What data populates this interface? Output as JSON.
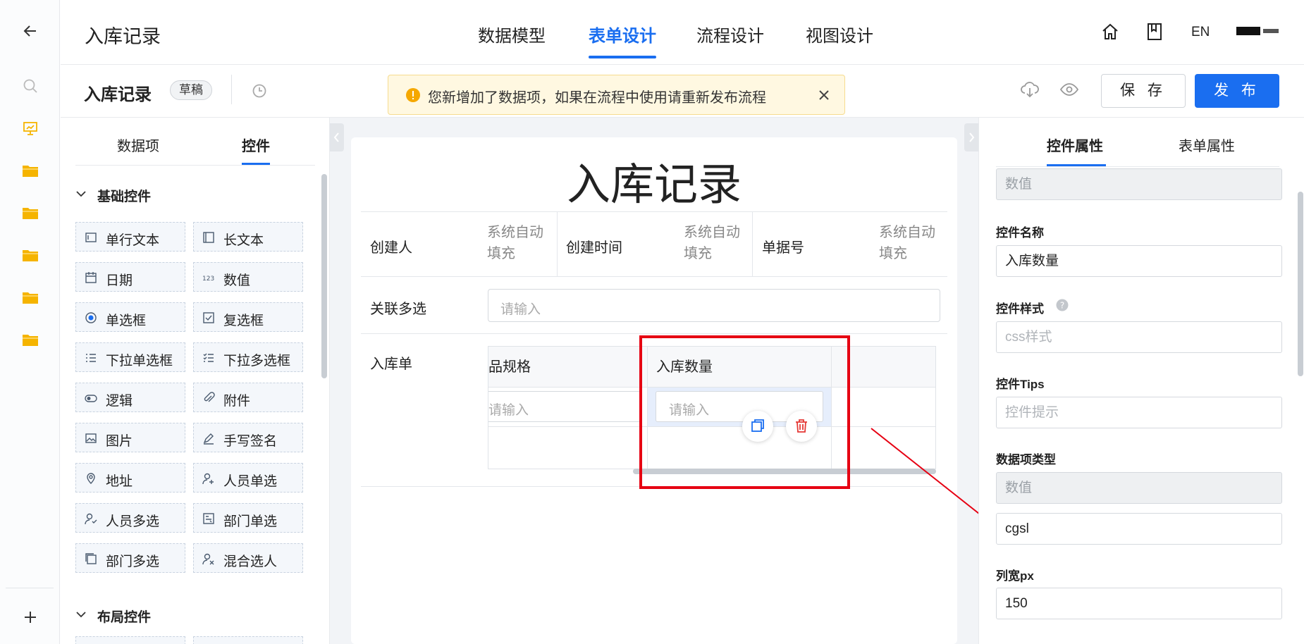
{
  "app": {
    "title": "入库记录"
  },
  "nav": {
    "tabs": [
      "数据模型",
      "表单设计",
      "流程设计",
      "视图设计"
    ],
    "active_tab": "表单设计",
    "lang": "EN"
  },
  "subheader": {
    "form_name": "入库记录",
    "status_badge": "草稿",
    "notice": "您新增加了数据项，如果在流程中使用请重新发布流程",
    "save_label": "保 存",
    "publish_label": "发 布"
  },
  "left_panel": {
    "tabs": [
      "数据项",
      "控件"
    ],
    "active_tab": "控件",
    "sections": [
      {
        "title": "基础控件",
        "items": [
          "单行文本",
          "长文本",
          "日期",
          "数值",
          "单选框",
          "复选框",
          "下拉单选框",
          "下拉多选框",
          "逻辑",
          "附件",
          "图片",
          "手写签名",
          "地址",
          "人员单选",
          "人员多选",
          "部门单选",
          "部门多选",
          "混合选人"
        ]
      },
      {
        "title": "布局控件",
        "items": []
      }
    ],
    "icon_names": [
      "text-input-icon",
      "textarea-icon",
      "calendar-icon",
      "number-icon",
      "radio-icon",
      "checkbox-icon",
      "dropdown-icon",
      "multi-dropdown-icon",
      "toggle-icon",
      "paperclip-icon",
      "image-icon",
      "pen-icon",
      "location-icon",
      "user-add-icon",
      "users-icon",
      "department-icon",
      "departments-icon",
      "mixed-users-icon"
    ]
  },
  "canvas": {
    "title": "入库记录",
    "fields": [
      {
        "label": "创建人",
        "value": "系统自动\n填充"
      },
      {
        "label": "创建时间",
        "value": "系统自动\n填充"
      },
      {
        "label": "单据号",
        "value": "系统自动\n填充"
      }
    ],
    "multi_select": {
      "label": "关联多选",
      "placeholder": "请输入"
    },
    "subform": {
      "label": "入库单",
      "columns": [
        "品规格",
        "入库数量"
      ],
      "placeholders": [
        "请输入",
        "请输入"
      ]
    }
  },
  "right_panel": {
    "tabs": [
      "控件属性",
      "表单属性"
    ],
    "active_tab": "控件属性",
    "top_value": "数值",
    "control_name": {
      "label": "控件名称",
      "value": "入库数量"
    },
    "control_style": {
      "label": "控件样式",
      "placeholder": "css样式"
    },
    "control_tips": {
      "label": "控件Tips",
      "placeholder": "控件提示"
    },
    "data_type": {
      "label": "数据项类型",
      "value": "数值"
    },
    "field_code": "cgsl",
    "column_width": {
      "label": "列宽px",
      "value": "150"
    }
  },
  "colors": {
    "accent": "#1a6ef0",
    "highlight_box": "#e60012",
    "folder": "#f5b400",
    "notice_bg": "#fff8e1"
  }
}
